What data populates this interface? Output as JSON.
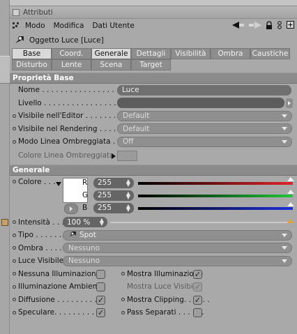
{
  "window_title": "Attributi",
  "menu": [
    "Modo",
    "Modifica",
    "Dati Utente"
  ],
  "object_title": "Oggetto Luce [Luce]",
  "tabs_row1": [
    {
      "label": "Base",
      "selected": true
    },
    {
      "label": "Coord.",
      "selected": false
    },
    {
      "label": "Generale",
      "selected": true
    },
    {
      "label": "Dettagli",
      "selected": false
    },
    {
      "label": "Visibilità",
      "selected": false
    },
    {
      "label": "Ombra",
      "selected": false
    },
    {
      "label": "Caustiche",
      "selected": false
    }
  ],
  "tabs_row2": [
    {
      "label": "Disturbo",
      "selected": false
    },
    {
      "label": "Lente",
      "selected": false
    },
    {
      "label": "Scena",
      "selected": false
    },
    {
      "label": "Target",
      "selected": false
    }
  ],
  "base": {
    "heading": "Proprietà Base",
    "name_label": "Nome . . . . . . . . . . . . . . . . . .",
    "name_value": "Luce",
    "layer_label": "Livello . . . . . . . . . . . . . . . . .",
    "editor_label": "Visibile nell'Editor . . . . . . . .",
    "editor_value": "Default",
    "render_label": "Visibile nel Rendering . . . . . .",
    "render_value": "Default",
    "shade_label": "Modo Linea Ombreggiata . . .",
    "shade_value": "Off",
    "shadecolor_label": "Colore Linea Ombreggiata"
  },
  "general": {
    "heading": "Generale",
    "color_label": "Colore . . .",
    "r_label": "R",
    "r_value": "255",
    "g_label": "G",
    "g_value": "255",
    "b_label": "B",
    "b_value": "255",
    "intensity_label": "Intensità . . . .",
    "intensity_value": "100 %",
    "type_label": "Tipo . . . . . . .",
    "type_value": "Spot",
    "shadow_label": "Ombra . . . . .",
    "shadow_value": "Nessuno",
    "visible_label": "Luce Visibile",
    "visible_value": "Nessuno",
    "checks": [
      {
        "label": "Nessuna Illuminazione",
        "checked": false,
        "dim": false
      },
      {
        "label": "Mostra Illuminazione",
        "checked": true,
        "dim": false
      },
      {
        "label": "Illuminazione Ambiente",
        "checked": false,
        "dim": false
      },
      {
        "label": "Mostra Luce Visibile",
        "checked": true,
        "dim": true
      },
      {
        "label": "Diffusione . . . . . . . . . .",
        "checked": true,
        "dim": false
      },
      {
        "label": "Mostra Clipping. . . . . .",
        "checked": true,
        "dim": false
      },
      {
        "label": "Speculare. . . . . . . . . . .",
        "checked": true,
        "dim": false
      },
      {
        "label": "Pass Separati . . . . . .",
        "checked": false,
        "dim": false
      }
    ]
  },
  "colors": {
    "tab_selected": "#d9d9d9",
    "red": "#e0242a",
    "green": "#22c43a",
    "blue": "#1e2fd8",
    "swatch": "#ffffff"
  }
}
